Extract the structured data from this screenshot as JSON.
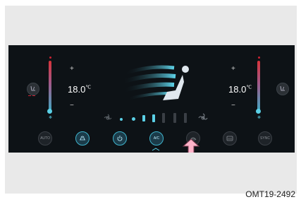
{
  "climate": {
    "left_temp": "18.0",
    "right_temp": "18.0",
    "temp_unit": "℃",
    "plus": "+",
    "minus": "−",
    "fan_speed_level": 0.5,
    "bottom_buttons": [
      "AUTO",
      "",
      "",
      "A/C",
      "",
      "",
      "SYNC"
    ]
  },
  "caption": "OMT19-2492",
  "colors": {
    "screen_bg": "#0d1216",
    "accent": "#3fb3cc",
    "arrow": "#ffb3c9"
  }
}
